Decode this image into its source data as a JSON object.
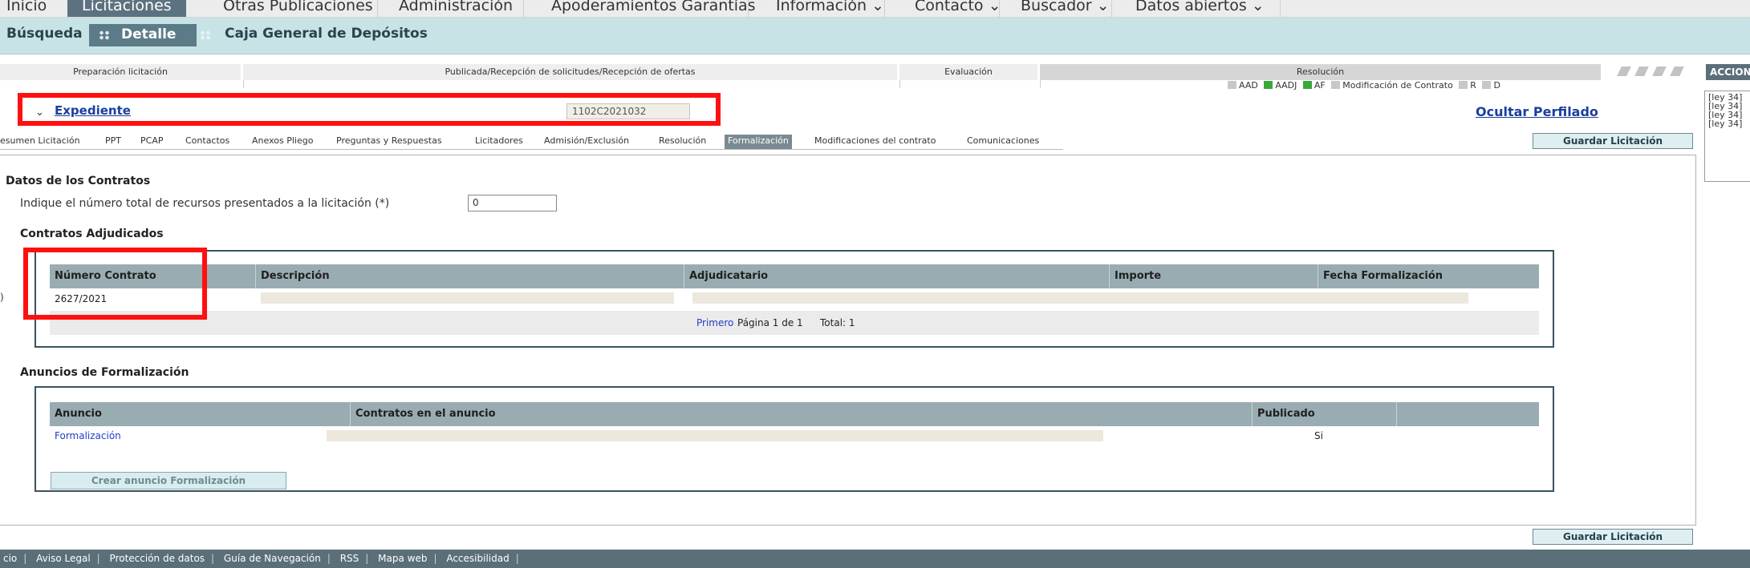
{
  "top_nav": {
    "items": [
      "Inicio",
      "Licitaciones",
      "Otras Publicaciones",
      "Administración",
      "Apoderamientos Garantías",
      "Información ⌄",
      "Contacto ⌄",
      "Buscador ⌄",
      "Datos abiertos ⌄"
    ],
    "active": "Licitaciones"
  },
  "sub_nav": {
    "items": [
      "Búsqueda",
      "Detalle",
      "Caja General de Depósitos"
    ],
    "active": "Detalle"
  },
  "phases": {
    "items": [
      "Preparación licitación",
      "Publicada/Recepción de solicitudes/Recepción de ofertas",
      "Evaluación",
      "Resolución"
    ],
    "legend": [
      {
        "label": "AAD",
        "color": "#c8c8c8"
      },
      {
        "label": "AADJ",
        "color": "#3aa83a"
      },
      {
        "label": "AF",
        "color": "#3aa83a"
      },
      {
        "label": "Modificación de Contrato",
        "color": "#c8c8c8"
      },
      {
        "label": "R",
        "color": "#c8c8c8"
      },
      {
        "label": "D",
        "color": "#c8c8c8"
      }
    ]
  },
  "acciones": {
    "title": "ACCION",
    "lines": [
      "[ley 34]",
      "[ley 34]",
      "[ley 34]",
      "[ley 34]"
    ]
  },
  "expediente": {
    "label": "Expediente",
    "value": "1102C2021032",
    "ocultar": "Ocultar Perfilado"
  },
  "tabs": {
    "items": [
      "esumen Licitación",
      "PPT",
      "PCAP",
      "Contactos",
      "Anexos Pliego",
      "Preguntas y Respuestas",
      "Licitadores",
      "Admisión/Exclusión",
      "Resolución",
      "Formalización",
      "Modificaciones del contrato",
      "Comunicaciones"
    ],
    "active": "Formalización"
  },
  "guardar_label": "Guardar Licitación",
  "datos": {
    "title": "Datos de los Contratos",
    "recursos_label": "Indique el número total de recursos presentados a la licitación (*)",
    "recursos_value": "0",
    "contratos_title": "Contratos Adjudicados"
  },
  "contratos_table": {
    "headers": [
      "Número Contrato",
      "Descripción",
      "Adjudicatario",
      "Importe",
      "Fecha Formalización"
    ],
    "rows": [
      [
        "2627/2021",
        "",
        "",
        "",
        ""
      ]
    ],
    "pager": {
      "first": "Primero",
      "page": "Página 1 de 1",
      "total": "Total: 1"
    }
  },
  "anuncios": {
    "title": "Anuncios de Formalización",
    "headers": [
      "Anuncio",
      "Contratos en el anuncio",
      "Publicado",
      ""
    ],
    "rows": [
      [
        "Formalización",
        "",
        "Si",
        ""
      ]
    ],
    "crear_label": "Crear anuncio Formalización"
  },
  "footer": {
    "items": [
      "cio",
      "Aviso Legal",
      "Protección de datos",
      "Guía de Navegación",
      "RSS",
      "Mapa web",
      "Accesibilidad"
    ]
  },
  "left_mark": ")"
}
